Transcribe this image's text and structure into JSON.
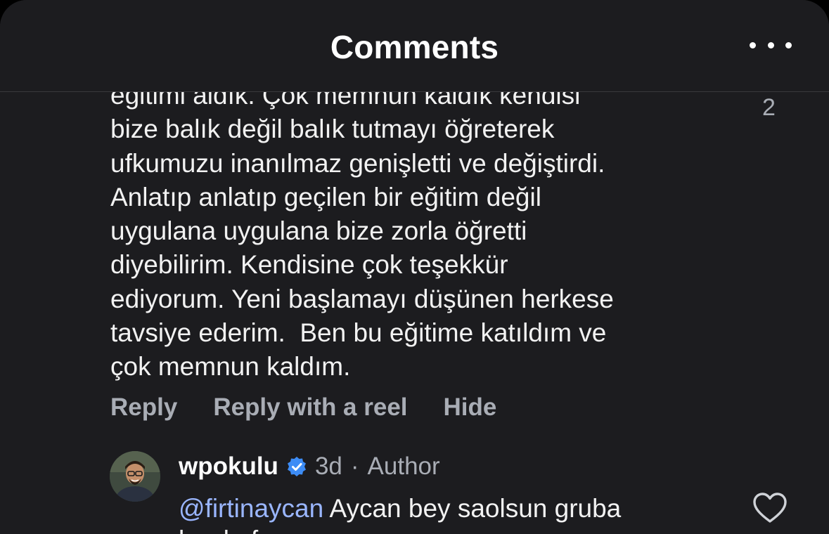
{
  "header": {
    "title": "Comments",
    "more_icon": "more-horizontal-icon"
  },
  "comment": {
    "text_lines": [
      "eğitimi aldık. Çok memnun kaldık kendisi",
      "bize balık değil balık tutmayı öğreterek",
      "ufkumuzu inanılmaz genişletti ve değiştirdi.",
      "Anlatıp anlatıp geçilen bir eğitim değil",
      "uygulana uygulana bize zorla öğretti",
      "diyebilirim. Kendisine çok teşekkür",
      "ediyorum. Yeni başlamayı düşünen herkese",
      "tavsiye ederim.  Ben bu eğitime katıldım ve",
      "çok memnun kaldım."
    ],
    "like_count": "2",
    "actions": {
      "reply": "Reply",
      "reply_with_reel": "Reply with a reel",
      "hide": "Hide"
    }
  },
  "reply": {
    "username": "wpokulu",
    "verified_icon": "verified-badge-icon",
    "time": "3d",
    "separator": "·",
    "role": "Author",
    "mention": "@firtinaycan",
    "text": " Aycan bey saolsun gruba",
    "text_partial": "bu da fır...",
    "heart_icon": "heart-outline-icon"
  },
  "colors": {
    "background": "#1c1c1f",
    "text": "#f2f2f2",
    "muted": "#a9adb5",
    "mention": "#9ab6ff",
    "verified": "#3d8cf5"
  }
}
